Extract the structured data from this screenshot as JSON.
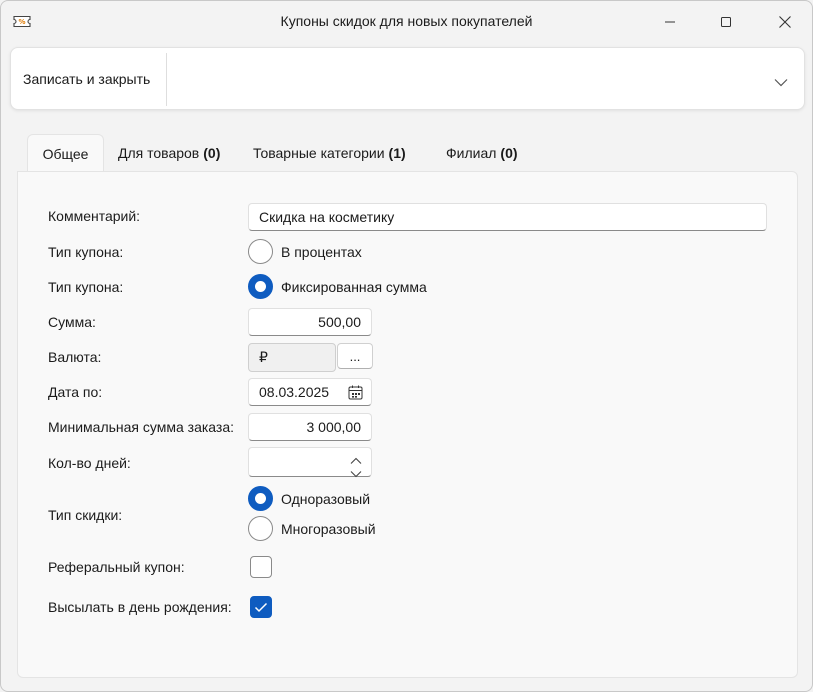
{
  "window": {
    "title": "Купоны скидок для новых покупателей"
  },
  "toolbar": {
    "save_close_label": "Записать и закрыть"
  },
  "tabs": [
    {
      "label": "Общее",
      "count": ""
    },
    {
      "label": "Для товаров",
      "count": "(0)"
    },
    {
      "label": "Товарные категории",
      "count": "(1)"
    },
    {
      "label": "Филиал",
      "count": "(0)"
    }
  ],
  "form": {
    "comment": {
      "label": "Комментарий:",
      "value": "Скидка на косметику"
    },
    "coupon_type_1": {
      "label": "Тип купона:",
      "option": "В процентах",
      "checked": false
    },
    "coupon_type_2": {
      "label": "Тип купона:",
      "option": "Фиксированная сумма",
      "checked": true
    },
    "amount": {
      "label": "Сумма:",
      "value": "500,00"
    },
    "currency": {
      "label": "Валюта:",
      "value": "₽",
      "select_button": "..."
    },
    "date_to": {
      "label": "Дата по:",
      "value": "08.03.2025"
    },
    "min_order": {
      "label": "Минимальная сумма заказа:",
      "value": "3 000,00"
    },
    "days_count": {
      "label": "Кол-во дней:",
      "value": ""
    },
    "discount_type": {
      "label": "Тип скидки:",
      "options": [
        {
          "label": "Одноразовый",
          "checked": true
        },
        {
          "label": "Многоразовый",
          "checked": false
        }
      ]
    },
    "referral": {
      "label": "Реферальный купон:",
      "checked": false
    },
    "birthday": {
      "label": "Высылать в день рождения:",
      "checked": true
    }
  },
  "colors": {
    "accent": "#0f5cc0",
    "window_bg": "#f3f3f3",
    "panel_bg": "#f9f9f9"
  }
}
